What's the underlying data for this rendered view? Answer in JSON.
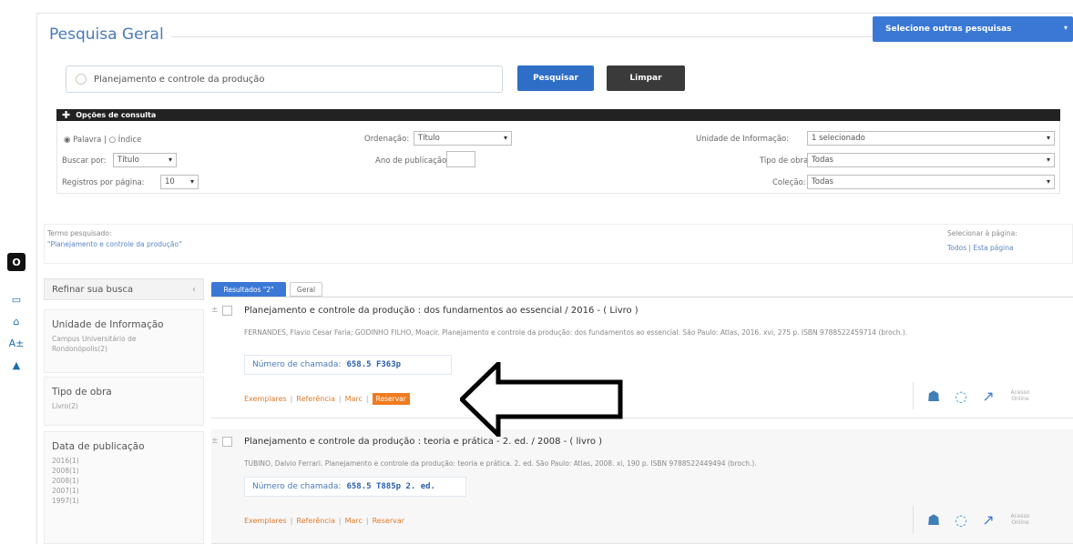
{
  "header": {
    "title": "Pesquisa Geral",
    "new_search_label": "Selecione outras pesquisas",
    "new_search_caret": "▾"
  },
  "search": {
    "value": "Planejamento e controle da produção",
    "search_btn": "Pesquisar",
    "clear_btn": "Limpar"
  },
  "options": {
    "bar_label": "Opções de consulta",
    "radio_words": "Palavra",
    "radio_index": "Índice",
    "search_by_label": "Buscar por:",
    "search_by_value": "Título",
    "per_page_label": "Registros por página:",
    "per_page_value": "10",
    "order_label": "Ordenação:",
    "order_value": "Título",
    "year_label": "Ano de publicação:",
    "unit_label": "Unidade de Informação:",
    "unit_value": "1 selecionado",
    "work_type_label": "Tipo de obra:",
    "work_type_value": "Todas",
    "collection_label": "Coleção:",
    "collection_value": "Todas"
  },
  "searched": {
    "label": "Termo pesquisado:",
    "value": "\"Planejamento e controle da produção\"",
    "select_label": "Selecionar à página:",
    "select_all": "Todos",
    "select_page": "Esta página"
  },
  "sidebar": {
    "refine_label": "Refinar sua busca",
    "facets": [
      {
        "title": "Unidade de Informação",
        "lines": [
          "Campus Universitário de",
          "Rondonópolis(2)"
        ]
      },
      {
        "title": "Tipo de obra",
        "lines": [
          "Livro(2)"
        ]
      },
      {
        "title": "Data de publicação",
        "lines": [
          "2016(1)",
          "2008(1)",
          "2008(1)",
          "2007(1)",
          "1997(1)"
        ]
      }
    ]
  },
  "tabs": {
    "results": "Resultados \"2\"",
    "other": "Geral"
  },
  "records": [
    {
      "title": "Planejamento e controle da produção : dos fundamentos ao essencial / 2016 - ( Livro )",
      "reference": "FERNANDES, Flavio Cesar Faria; GODINHO FILHO, Moacir. Planejamento e controle da produção: dos fundamentos ao essencial. São Paulo: Atlas, 2016. xvi, 275 p. ISBN 9788522459714 (broch.).",
      "call_label": "Número de chamada:",
      "call_value": "658.5 F363p",
      "actions": [
        "Exemplares",
        "Referência",
        "Marc"
      ],
      "reserve": "Reservar"
    },
    {
      "title": "Planejamento e controle da produção : teoria e prática - 2. ed. / 2008 - ( livro )",
      "reference": "TUBINO, Dalvio Ferrari. Planejamento e controle da produção: teoria e prática. 2. ed. São Paulo: Atlas, 2008. xi, 190 p. ISBN 9788522449494 (broch.).",
      "call_label": "Número de chamada:",
      "call_value": "658.5 T885p 2. ed.",
      "actions": [
        "Exemplares",
        "Referência",
        "Marc"
      ],
      "reserve": "Reservar"
    }
  ],
  "record_icons": {
    "more": "Acesso Online"
  },
  "dock": {
    "dark_label": "O"
  }
}
